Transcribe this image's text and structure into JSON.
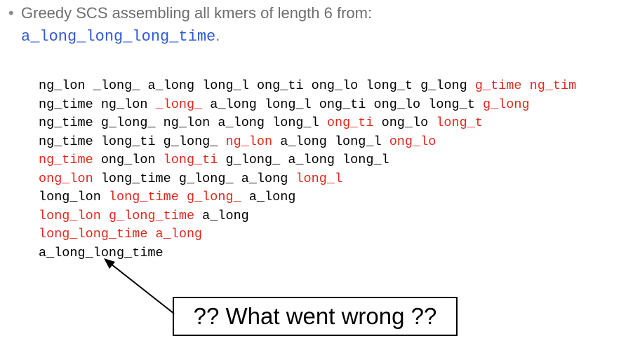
{
  "heading": {
    "bullet": "•",
    "text": "Greedy SCS assembling all kmers of length 6 from:",
    "target_string": "a_long_long_long_time",
    "period": "."
  },
  "steps": [
    [
      {
        "t": "ng_lon",
        "merged": false
      },
      {
        "t": "_long_",
        "merged": false
      },
      {
        "t": "a_long",
        "merged": false
      },
      {
        "t": "long_l",
        "merged": false
      },
      {
        "t": "ong_ti",
        "merged": false
      },
      {
        "t": "ong_lo",
        "merged": false
      },
      {
        "t": "long_t",
        "merged": false
      },
      {
        "t": "g_long",
        "merged": false
      },
      {
        "t": "g_time",
        "merged": true
      },
      {
        "t": "ng_tim",
        "merged": true
      }
    ],
    [
      {
        "t": "ng_time",
        "merged": false
      },
      {
        "t": "ng_lon",
        "merged": false
      },
      {
        "t": "_long_",
        "merged": true
      },
      {
        "t": "a_long",
        "merged": false
      },
      {
        "t": "long_l",
        "merged": false
      },
      {
        "t": "ong_ti",
        "merged": false
      },
      {
        "t": "ong_lo",
        "merged": false
      },
      {
        "t": "long_t",
        "merged": false
      },
      {
        "t": "g_long",
        "merged": true
      }
    ],
    [
      {
        "t": "ng_time",
        "merged": false
      },
      {
        "t": "g_long_",
        "merged": false
      },
      {
        "t": "ng_lon",
        "merged": false
      },
      {
        "t": "a_long",
        "merged": false
      },
      {
        "t": "long_l",
        "merged": false
      },
      {
        "t": "ong_ti",
        "merged": true
      },
      {
        "t": "ong_lo",
        "merged": false
      },
      {
        "t": "long_t",
        "merged": true
      }
    ],
    [
      {
        "t": "ng_time",
        "merged": false
      },
      {
        "t": "long_ti",
        "merged": false
      },
      {
        "t": "g_long_",
        "merged": false
      },
      {
        "t": "ng_lon",
        "merged": true
      },
      {
        "t": "a_long",
        "merged": false
      },
      {
        "t": "long_l",
        "merged": false
      },
      {
        "t": "ong_lo",
        "merged": true
      }
    ],
    [
      {
        "t": "ng_time",
        "merged": true
      },
      {
        "t": "ong_lon",
        "merged": false
      },
      {
        "t": "long_ti",
        "merged": true
      },
      {
        "t": "g_long_",
        "merged": false
      },
      {
        "t": "a_long",
        "merged": false
      },
      {
        "t": "long_l",
        "merged": false
      }
    ],
    [
      {
        "t": "ong_lon",
        "merged": true
      },
      {
        "t": "long_time",
        "merged": false
      },
      {
        "t": "g_long_",
        "merged": false
      },
      {
        "t": "a_long",
        "merged": false
      },
      {
        "t": "long_l",
        "merged": true
      }
    ],
    [
      {
        "t": "long_lon",
        "merged": false
      },
      {
        "t": "long_time",
        "merged": true
      },
      {
        "t": "g_long_",
        "merged": true
      },
      {
        "t": "a_long",
        "merged": false
      }
    ],
    [
      {
        "t": "long_lon",
        "merged": true
      },
      {
        "t": "g_long_time",
        "merged": true
      },
      {
        "t": "a_long",
        "merged": false
      }
    ],
    [
      {
        "t": "long_long_time",
        "merged": true
      },
      {
        "t": "a_long",
        "merged": true
      }
    ],
    [
      {
        "t": "a_long_long_time",
        "merged": false
      }
    ]
  ],
  "callout": {
    "text": "?? What went wrong ??"
  },
  "colors": {
    "default_kmer": "#000000",
    "merged_kmer": "#e0291d",
    "target_string": "#2f5bd1",
    "heading_text": "#6e6e6e"
  }
}
